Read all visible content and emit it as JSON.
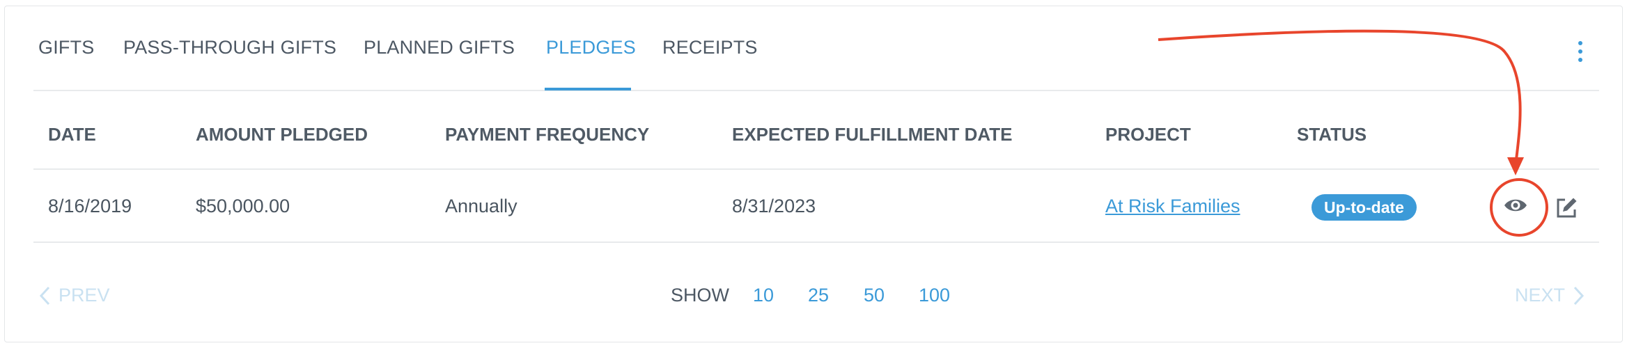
{
  "tabs": [
    {
      "label": "GIFTS",
      "active": false
    },
    {
      "label": "PASS-THROUGH GIFTS",
      "active": false
    },
    {
      "label": "PLANNED GIFTS",
      "active": false
    },
    {
      "label": "PLEDGES",
      "active": true
    },
    {
      "label": "RECEIPTS",
      "active": false
    }
  ],
  "more_menu_icon": "vertical-ellipsis-icon",
  "table": {
    "columns": [
      "DATE",
      "AMOUNT PLEDGED",
      "PAYMENT FREQUENCY",
      "EXPECTED FULFILLMENT DATE",
      "PROJECT",
      "STATUS"
    ],
    "rows": [
      {
        "date": "8/16/2019",
        "amount": "$50,000.00",
        "frequency": "Annually",
        "fulfillment_date": "8/31/2023",
        "project": "At Risk Families",
        "status": "Up-to-date",
        "actions": [
          "eye-icon",
          "edit-icon"
        ]
      }
    ]
  },
  "pagination": {
    "prev_label": "PREV",
    "next_label": "NEXT",
    "show_label": "SHOW",
    "page_sizes": [
      "10",
      "25",
      "50",
      "100"
    ]
  },
  "colors": {
    "accent": "#3b9ad8",
    "text": "#4a5560",
    "annotation": "#e8452c",
    "disabled": "#c9e1f1"
  }
}
